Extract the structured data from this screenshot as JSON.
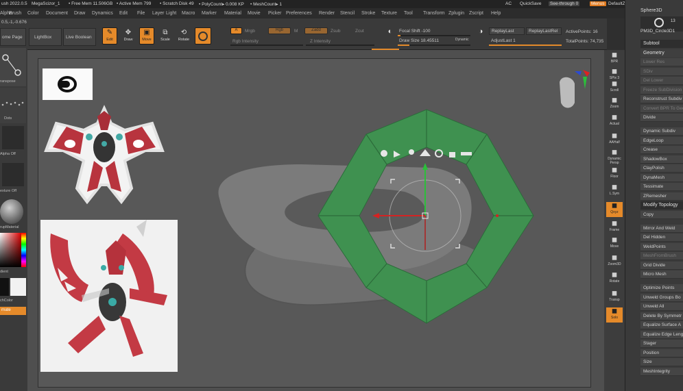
{
  "status": {
    "app": "ush 2022.0.5",
    "doc": "MegaScizor_1",
    "free_mem": "• Free Mem 11.506GB",
    "active_mem": "• Active Mem 799",
    "scratch": "• Scratch Disk 49",
    "polycount": "• PolyCount▸ 0.008 KP",
    "meshcount": "• MeshCount▸ 1",
    "ac": "AC",
    "quicksave": "QuickSave",
    "seethrough": "See-through 0",
    "menus": "Menus",
    "script": "DefaultZScript"
  },
  "menubar": [
    "Alpha",
    "Brush",
    "Color",
    "Document",
    "Draw",
    "Dynamics",
    "Edit",
    "File",
    "Layer",
    "Light",
    "Macro",
    "Marker",
    "Material",
    "Movie",
    "Picker",
    "Preferences",
    "Render",
    "Stencil",
    "Stroke",
    "Texture",
    "Tool",
    "Transform",
    "Zplugin",
    "Zscript",
    "Help"
  ],
  "toolbar": {
    "coords": "0.5,-1,-0.676",
    "home": "ome Page",
    "lightbox": "LightBox",
    "liveboolean": "Live Boolean",
    "edit": "Edit",
    "draw": "Draw",
    "move": "Move",
    "scale": "Scale",
    "rotate": "Rotate",
    "a": "A",
    "mrgb": "Mrgb",
    "rgb": "Rgb",
    "m": "M",
    "zadd": "Zadd",
    "zsub": "Zsub",
    "zcut": "Zcut",
    "rgb_intensity": "Rgb Intensity",
    "z_intensity": "Z Intensity",
    "focal_shift": "Focal Shift -100",
    "draw_size": "Draw Size 18.45511",
    "dynamic": "Dynamic",
    "replay_last": "ReplayLast",
    "replay_last_rel": "ReplayLastRel",
    "adjust_last": "AdjustLast 1",
    "active_points": "ActivePoints: 16",
    "total_points": "TotalPoints: 74,735"
  },
  "lefttray": {
    "transpose": "ranspose",
    "dots": "Dots",
    "alpha_off": "Alpha Off",
    "texture_off": "exture Off",
    "matcap": "rupMaterial",
    "gradient": "dient",
    "switch_color": "chColor",
    "alternate": "rnate"
  },
  "rightstrip": [
    "BPR",
    "SPix 3",
    "Scroll",
    "Zoom",
    "Actual",
    "AAHalf",
    "Dynamic Persp",
    "Floor",
    "L.Sym",
    "Qxyz",
    "Frame",
    "Move",
    "Zoom3D",
    "Rotate",
    "Transp",
    "Solo"
  ],
  "rightpanel": {
    "tool_name": "Sphere3D",
    "tool_count": "13",
    "tool_sub": "PM3D_Circle3D1",
    "subtool": "Subtool",
    "geometry": "Geometry",
    "items": [
      "Lower Res",
      "SDiv",
      "Del Lower",
      "Freeze SubDivision",
      "Reconstruct Subdiv",
      "Convert BPR To Geo",
      "Divide",
      "Dynamic Subdiv",
      "EdgeLoop",
      "Crease",
      "ShadowBox",
      "ClayPolish",
      "DynaMesh",
      "Tessimate",
      "ZRemesher",
      "Modify Topology",
      "Copy",
      "Mirror And Weld",
      "Del Hidden",
      "WeldPoints",
      "MeshFromBrush",
      "Grid Divide",
      "Micro Mesh",
      "Optimize Points",
      "Unweld Groups Bo",
      "Unweld All",
      "Delete By Symmetr",
      "Equalize Surface A",
      "Equalize Edge Leng",
      "Stager",
      "Position",
      "Size",
      "MeshIntegrity"
    ]
  },
  "colors": {
    "accent": "#e58a2a",
    "gizmo_green": "#3e8f4f",
    "bg": "#4f4f4f"
  }
}
